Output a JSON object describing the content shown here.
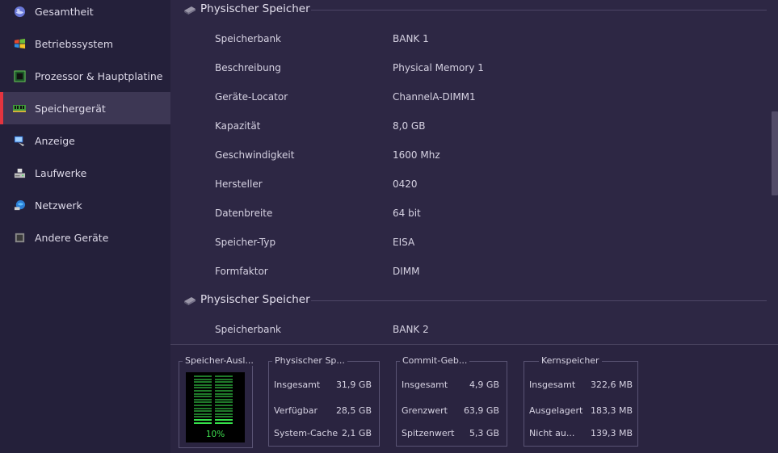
{
  "sidebar": {
    "items": [
      {
        "label": "Gesamtheit",
        "icon": "globe-icon",
        "active": false
      },
      {
        "label": "Betriebssystem",
        "icon": "windows-logo-icon",
        "active": false
      },
      {
        "label": "Prozessor & Hauptplatine",
        "icon": "cpu-chip-icon",
        "active": false
      },
      {
        "label": "Speichergerät",
        "icon": "ram-module-icon",
        "active": true
      },
      {
        "label": "Anzeige",
        "icon": "monitor-icon",
        "active": false
      },
      {
        "label": "Laufwerke",
        "icon": "drive-icon",
        "active": false
      },
      {
        "label": "Netzwerk",
        "icon": "network-globe-icon",
        "active": false
      },
      {
        "label": "Andere Geräte",
        "icon": "device-icon",
        "active": false
      }
    ]
  },
  "main": {
    "sections": [
      {
        "title": "Physischer Speicher",
        "rows": [
          {
            "key": "Speicherbank",
            "value": "BANK 1"
          },
          {
            "key": "Beschreibung",
            "value": "Physical Memory 1"
          },
          {
            "key": "Geräte-Locator",
            "value": "ChannelA-DIMM1"
          },
          {
            "key": "Kapazität",
            "value": "8,0 GB"
          },
          {
            "key": "Geschwindigkeit",
            "value": "1600 Mhz"
          },
          {
            "key": "Hersteller",
            "value": "0420"
          },
          {
            "key": "Datenbreite",
            "value": "64 bit"
          },
          {
            "key": "Speicher-Typ",
            "value": "EISA"
          },
          {
            "key": "Formfaktor",
            "value": "DIMM"
          }
        ]
      },
      {
        "title": "Physischer Speicher",
        "rows": [
          {
            "key": "Speicherbank",
            "value": "BANK 2"
          }
        ]
      }
    ]
  },
  "bottom": {
    "usage": {
      "title": "Speicher-Ausl...",
      "percent_label": "10%",
      "percent": 10
    },
    "groups": [
      {
        "title": "Physischer Sp...",
        "rows": [
          {
            "key": "Insgesamt",
            "value": "31,9 GB"
          },
          {
            "key": "Verfügbar",
            "value": "28,5 GB"
          },
          {
            "key": "System-Cache",
            "value": "2,1 GB"
          }
        ]
      },
      {
        "title": "Commit-Geb...",
        "rows": [
          {
            "key": "Insgesamt",
            "value": "4,9 GB"
          },
          {
            "key": "Grenzwert",
            "value": "63,9 GB"
          },
          {
            "key": "Spitzenwert",
            "value": "5,3 GB"
          }
        ]
      },
      {
        "title": "Kernspeicher",
        "rows": [
          {
            "key": "Insgesamt",
            "value": "322,6 MB"
          },
          {
            "key": "Ausgelagert",
            "value": "183,3 MB"
          },
          {
            "key": "Nicht au...",
            "value": "139,3 MB"
          }
        ]
      }
    ]
  },
  "colors": {
    "accent": "#e3343f",
    "meter_on": "#35e04a",
    "meter_off": "#1f7a2a"
  }
}
